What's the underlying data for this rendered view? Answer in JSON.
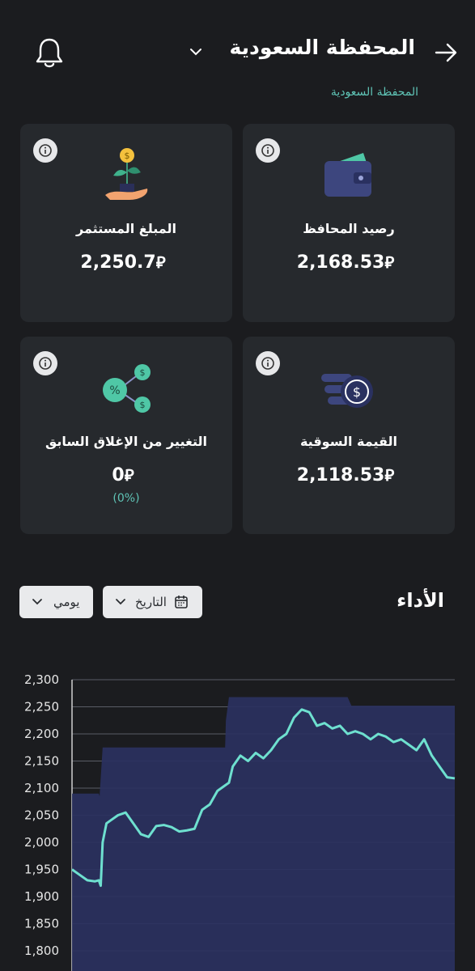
{
  "header": {
    "title": "المحفظة السعودية",
    "subtitle": "المحفظة السعودية"
  },
  "cards": {
    "invested": {
      "label": "المبلغ المستثمر",
      "value": "2,250.7",
      "currency": "⃁"
    },
    "balance": {
      "label": "رصيد المحافظ",
      "value": "2,168.53",
      "currency": "⃁"
    },
    "change": {
      "label": "التغيير من الإغلاق السابق",
      "value": "0",
      "currency": "⃁",
      "percent": "(0%)"
    },
    "market": {
      "label": "القيمة السوقية",
      "value": "2,118.53",
      "currency": "⃁"
    }
  },
  "performance": {
    "title": "الأداء",
    "date_filter_label": "التاريخ",
    "period_label": "يومي"
  },
  "colors": {
    "accent": "#5fc4b6",
    "card_bg": "#26292d",
    "page_bg": "#1b1c1f",
    "area_fill": "#2a3160"
  },
  "chart_data": {
    "type": "area",
    "ylim": [
      1800,
      2300
    ],
    "y_ticks": [
      "2,300",
      "2,250",
      "2,200",
      "2,150",
      "2,100",
      "2,050",
      "2,000",
      "1,950",
      "1,900",
      "1,850",
      "1,800"
    ],
    "series": [
      {
        "kind": "invested-area",
        "x": [
          0,
          0.07,
          0.072,
          0.08,
          0.4,
          0.402,
          0.41,
          0.72,
          0.73,
          1
        ],
        "values": [
          2090,
          2090,
          2085,
          2175,
          2175,
          2225,
          2268,
          2268,
          2252,
          2252
        ]
      },
      {
        "kind": "market-line",
        "x": [
          0,
          0.02,
          0.04,
          0.06,
          0.07,
          0.075,
          0.08,
          0.09,
          0.1,
          0.12,
          0.14,
          0.16,
          0.18,
          0.2,
          0.22,
          0.24,
          0.26,
          0.28,
          0.3,
          0.32,
          0.34,
          0.36,
          0.38,
          0.4,
          0.41,
          0.42,
          0.44,
          0.46,
          0.48,
          0.5,
          0.52,
          0.54,
          0.56,
          0.58,
          0.6,
          0.62,
          0.64,
          0.66,
          0.68,
          0.7,
          0.72,
          0.74,
          0.76,
          0.78,
          0.8,
          0.82,
          0.84,
          0.86,
          0.88,
          0.9,
          0.92,
          0.94,
          0.96,
          0.98,
          1
        ],
        "values": [
          1950,
          1940,
          1930,
          1928,
          1930,
          1920,
          2000,
          2035,
          2040,
          2050,
          2055,
          2035,
          2015,
          2010,
          2030,
          2032,
          2028,
          2020,
          2022,
          2025,
          2060,
          2070,
          2095,
          2105,
          2110,
          2140,
          2160,
          2150,
          2165,
          2155,
          2170,
          2190,
          2200,
          2230,
          2245,
          2240,
          2215,
          2220,
          2210,
          2215,
          2200,
          2205,
          2200,
          2190,
          2200,
          2195,
          2185,
          2190,
          2180,
          2170,
          2190,
          2160,
          2140,
          2120,
          2118
        ]
      }
    ]
  }
}
